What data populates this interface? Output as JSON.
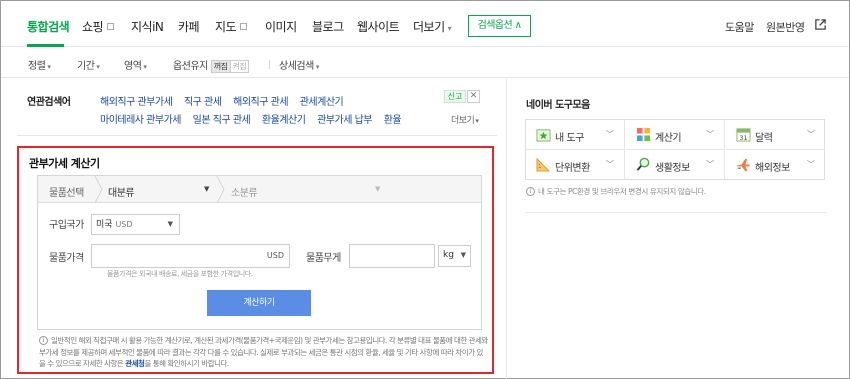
{
  "tabs": [
    {
      "label": "통합검색",
      "active": true
    },
    {
      "label": "쇼핑",
      "box": true
    },
    {
      "label": "지식iN"
    },
    {
      "label": "카페"
    },
    {
      "label": "지도",
      "box": true
    },
    {
      "label": "이미지"
    },
    {
      "label": "블로그"
    },
    {
      "label": "웹사이트"
    },
    {
      "label": "더보기",
      "chevron": true
    }
  ],
  "search_options_button": "검색옵션 ∧",
  "header_links": {
    "help": "도움말",
    "feedback": "원본반영"
  },
  "options": {
    "sort": "정렬",
    "period": "기간",
    "area": "영역",
    "option_keep": "옵션유지",
    "toggle_on": "꺼짐",
    "toggle_off": "켜짐",
    "detail": "상세검색"
  },
  "related": {
    "title": "연관검색어",
    "row1": [
      "해외직구 관부가세",
      "직구 관세",
      "해외직구 관세",
      "관세계산기"
    ],
    "row2": [
      "마이테레사 관부가세",
      "일본 직구 관세",
      "환율계산기",
      "관부가세 납부",
      "환율"
    ],
    "report": "신고",
    "more": "더보기"
  },
  "calculator": {
    "title": "관부가세 계산기",
    "category_label": "물품선택",
    "category_main": "대분류",
    "category_sub": "소분류",
    "country_label": "구입국가",
    "country_value": "미국",
    "country_unit": "USD",
    "price_label": "물품가격",
    "price_unit": "USD",
    "weight_label": "물품무게",
    "weight_unit": "kg",
    "hint": "물품가격은 외국내 배송료, 세금을 포함한 가격입니다.",
    "button": "계산하기",
    "notice_pre": "일반적인 해외 직접구매 시 활용 가능한 계산기로, 계산된 과세가격(물품가격+국제운임) 및 관부가세는 참고용입니다. 각 분류별 대표 물품에 대한 관세와 부가세 정보를 제공하며 세부적인 물품에 따라 결과는 각각 다를 수 있습니다. 실제로 부과되는 세금은 통관 시점의 환율, 세율 및 기타 사항에 따라 차이가 있을 수 있으므로 자세한 사항은 ",
    "notice_link": "관세청",
    "notice_post": "을 통해 확인하시기 바랍니다."
  },
  "tools": {
    "title": "네이버 도구모음",
    "items": [
      {
        "label": "내 도구",
        "icon": "star-icon"
      },
      {
        "label": "계산기",
        "icon": "calculator-icon"
      },
      {
        "label": "달력",
        "icon": "calendar-icon"
      },
      {
        "label": "단위변환",
        "icon": "ruler-icon"
      },
      {
        "label": "생활정보",
        "icon": "magnifier-icon"
      },
      {
        "label": "해외정보",
        "icon": "plane-icon"
      }
    ],
    "calendar_day": "31",
    "note": "내 도구는 PC환경 및 브라우저 변경시 유지되지 않습니다."
  }
}
